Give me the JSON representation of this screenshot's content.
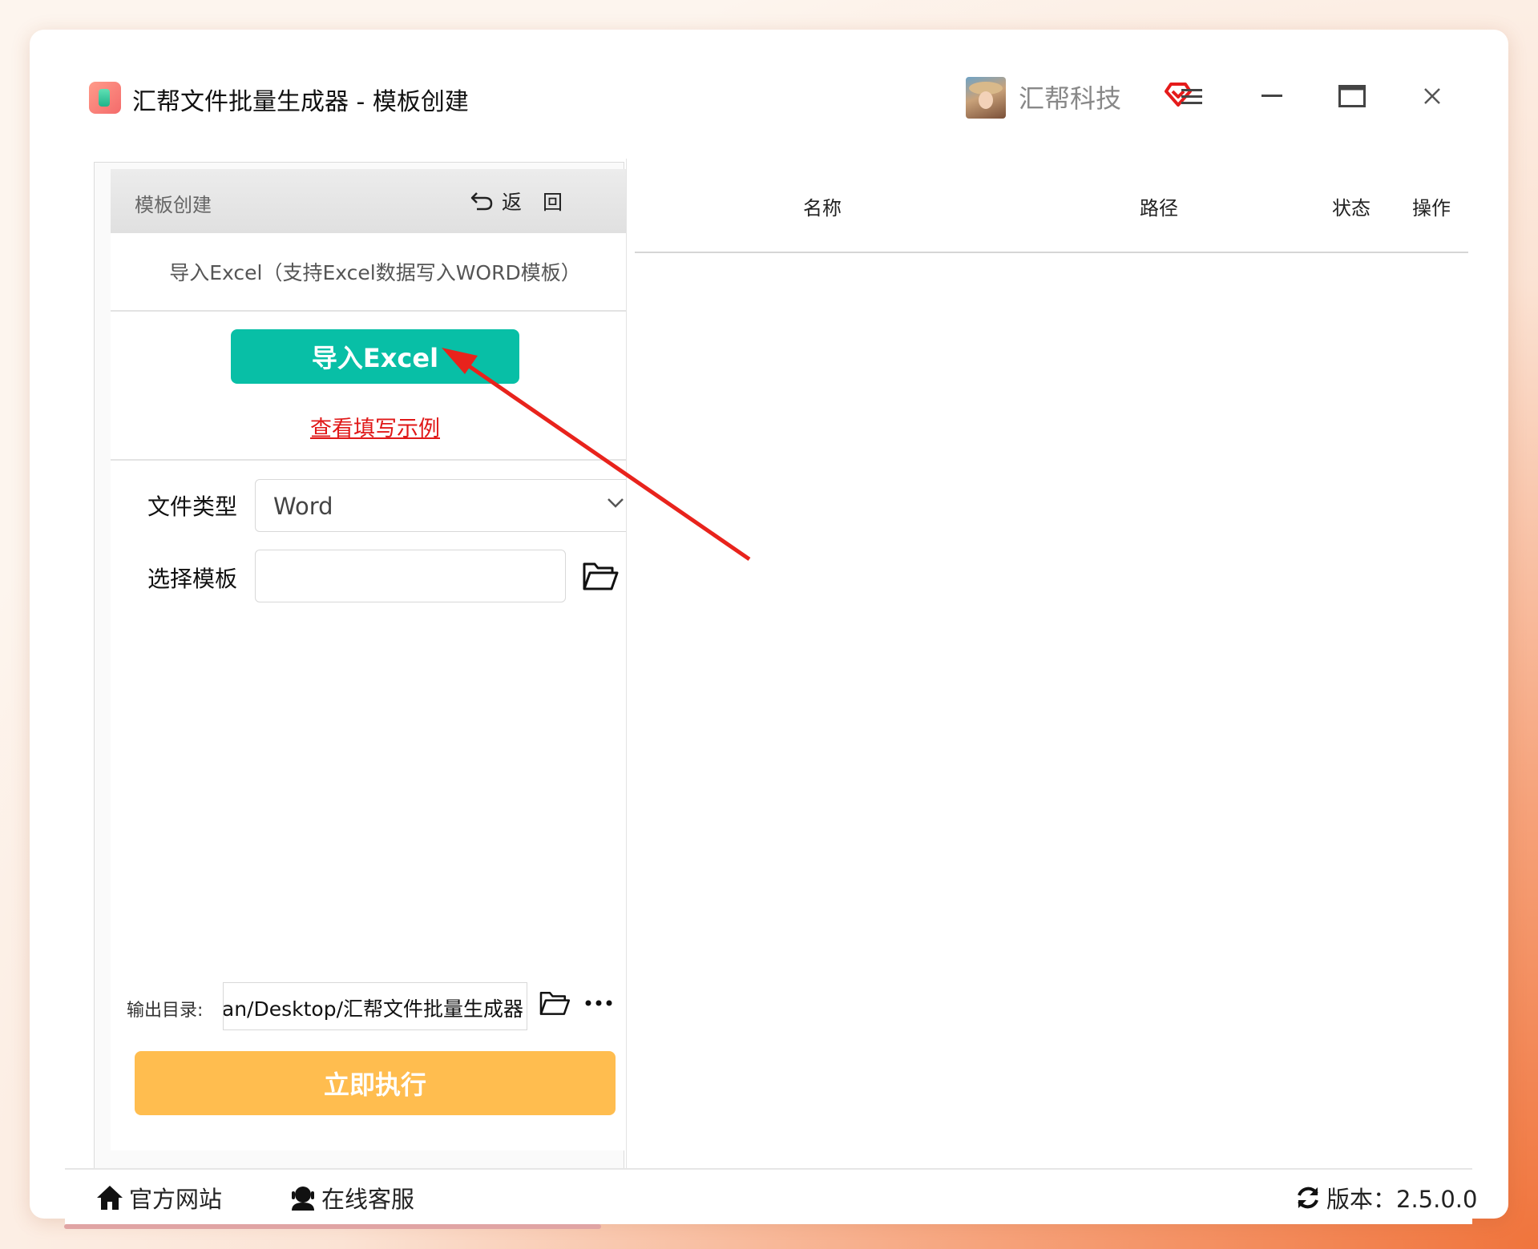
{
  "titlebar": {
    "title": "汇帮文件批量生成器 - 模板创建",
    "company": "汇帮科技"
  },
  "left_panel": {
    "header_title": "模板创建",
    "back_label": "返回",
    "hint": "导入Excel（支持Excel数据写入WORD模板）",
    "import_button": "导入Excel",
    "example_link": "查看填写示例",
    "file_type_label": "文件类型",
    "file_type_value": "Word",
    "template_label": "选择模板",
    "template_value": "",
    "output_label": "输出目录:",
    "output_value": "uan/Desktop/汇帮文件批量生成器",
    "run_button": "立即执行"
  },
  "table": {
    "columns": [
      "名称",
      "路径",
      "状态",
      "操作"
    ],
    "rows": []
  },
  "footer": {
    "website": "官方网站",
    "support": "在线客服",
    "version": "版本：2.5.0.0"
  },
  "colors": {
    "import_button": "#08bfa6",
    "run_button": "#ffbd4f",
    "example_link": "#e01818",
    "annotation_arrow": "#e8231c"
  },
  "icons": [
    "app-logo-icon",
    "vip-heart-icon",
    "menu-icon",
    "minimize-icon",
    "maximize-icon",
    "close-icon",
    "undo-arrow-icon",
    "chevron-down-icon",
    "folder-open-icon",
    "more-dots-icon",
    "home-icon",
    "user-headset-icon",
    "refresh-icon"
  ]
}
